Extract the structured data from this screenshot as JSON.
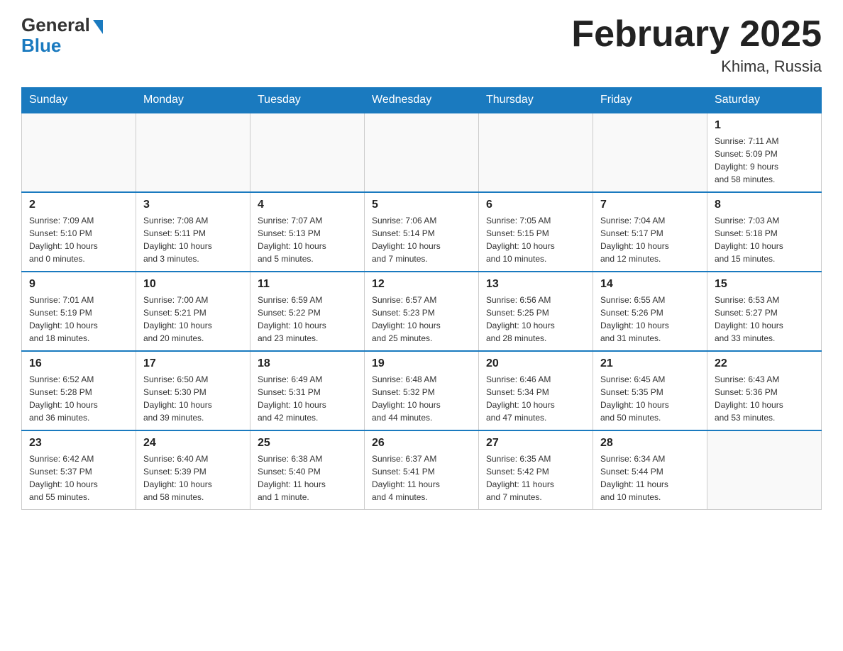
{
  "header": {
    "logo_general": "General",
    "logo_blue": "Blue",
    "month_title": "February 2025",
    "location": "Khima, Russia"
  },
  "days_of_week": [
    "Sunday",
    "Monday",
    "Tuesday",
    "Wednesday",
    "Thursday",
    "Friday",
    "Saturday"
  ],
  "weeks": [
    [
      {
        "day": "",
        "info": ""
      },
      {
        "day": "",
        "info": ""
      },
      {
        "day": "",
        "info": ""
      },
      {
        "day": "",
        "info": ""
      },
      {
        "day": "",
        "info": ""
      },
      {
        "day": "",
        "info": ""
      },
      {
        "day": "1",
        "info": "Sunrise: 7:11 AM\nSunset: 5:09 PM\nDaylight: 9 hours\nand 58 minutes."
      }
    ],
    [
      {
        "day": "2",
        "info": "Sunrise: 7:09 AM\nSunset: 5:10 PM\nDaylight: 10 hours\nand 0 minutes."
      },
      {
        "day": "3",
        "info": "Sunrise: 7:08 AM\nSunset: 5:11 PM\nDaylight: 10 hours\nand 3 minutes."
      },
      {
        "day": "4",
        "info": "Sunrise: 7:07 AM\nSunset: 5:13 PM\nDaylight: 10 hours\nand 5 minutes."
      },
      {
        "day": "5",
        "info": "Sunrise: 7:06 AM\nSunset: 5:14 PM\nDaylight: 10 hours\nand 7 minutes."
      },
      {
        "day": "6",
        "info": "Sunrise: 7:05 AM\nSunset: 5:15 PM\nDaylight: 10 hours\nand 10 minutes."
      },
      {
        "day": "7",
        "info": "Sunrise: 7:04 AM\nSunset: 5:17 PM\nDaylight: 10 hours\nand 12 minutes."
      },
      {
        "day": "8",
        "info": "Sunrise: 7:03 AM\nSunset: 5:18 PM\nDaylight: 10 hours\nand 15 minutes."
      }
    ],
    [
      {
        "day": "9",
        "info": "Sunrise: 7:01 AM\nSunset: 5:19 PM\nDaylight: 10 hours\nand 18 minutes."
      },
      {
        "day": "10",
        "info": "Sunrise: 7:00 AM\nSunset: 5:21 PM\nDaylight: 10 hours\nand 20 minutes."
      },
      {
        "day": "11",
        "info": "Sunrise: 6:59 AM\nSunset: 5:22 PM\nDaylight: 10 hours\nand 23 minutes."
      },
      {
        "day": "12",
        "info": "Sunrise: 6:57 AM\nSunset: 5:23 PM\nDaylight: 10 hours\nand 25 minutes."
      },
      {
        "day": "13",
        "info": "Sunrise: 6:56 AM\nSunset: 5:25 PM\nDaylight: 10 hours\nand 28 minutes."
      },
      {
        "day": "14",
        "info": "Sunrise: 6:55 AM\nSunset: 5:26 PM\nDaylight: 10 hours\nand 31 minutes."
      },
      {
        "day": "15",
        "info": "Sunrise: 6:53 AM\nSunset: 5:27 PM\nDaylight: 10 hours\nand 33 minutes."
      }
    ],
    [
      {
        "day": "16",
        "info": "Sunrise: 6:52 AM\nSunset: 5:28 PM\nDaylight: 10 hours\nand 36 minutes."
      },
      {
        "day": "17",
        "info": "Sunrise: 6:50 AM\nSunset: 5:30 PM\nDaylight: 10 hours\nand 39 minutes."
      },
      {
        "day": "18",
        "info": "Sunrise: 6:49 AM\nSunset: 5:31 PM\nDaylight: 10 hours\nand 42 minutes."
      },
      {
        "day": "19",
        "info": "Sunrise: 6:48 AM\nSunset: 5:32 PM\nDaylight: 10 hours\nand 44 minutes."
      },
      {
        "day": "20",
        "info": "Sunrise: 6:46 AM\nSunset: 5:34 PM\nDaylight: 10 hours\nand 47 minutes."
      },
      {
        "day": "21",
        "info": "Sunrise: 6:45 AM\nSunset: 5:35 PM\nDaylight: 10 hours\nand 50 minutes."
      },
      {
        "day": "22",
        "info": "Sunrise: 6:43 AM\nSunset: 5:36 PM\nDaylight: 10 hours\nand 53 minutes."
      }
    ],
    [
      {
        "day": "23",
        "info": "Sunrise: 6:42 AM\nSunset: 5:37 PM\nDaylight: 10 hours\nand 55 minutes."
      },
      {
        "day": "24",
        "info": "Sunrise: 6:40 AM\nSunset: 5:39 PM\nDaylight: 10 hours\nand 58 minutes."
      },
      {
        "day": "25",
        "info": "Sunrise: 6:38 AM\nSunset: 5:40 PM\nDaylight: 11 hours\nand 1 minute."
      },
      {
        "day": "26",
        "info": "Sunrise: 6:37 AM\nSunset: 5:41 PM\nDaylight: 11 hours\nand 4 minutes."
      },
      {
        "day": "27",
        "info": "Sunrise: 6:35 AM\nSunset: 5:42 PM\nDaylight: 11 hours\nand 7 minutes."
      },
      {
        "day": "28",
        "info": "Sunrise: 6:34 AM\nSunset: 5:44 PM\nDaylight: 11 hours\nand 10 minutes."
      },
      {
        "day": "",
        "info": ""
      }
    ]
  ]
}
